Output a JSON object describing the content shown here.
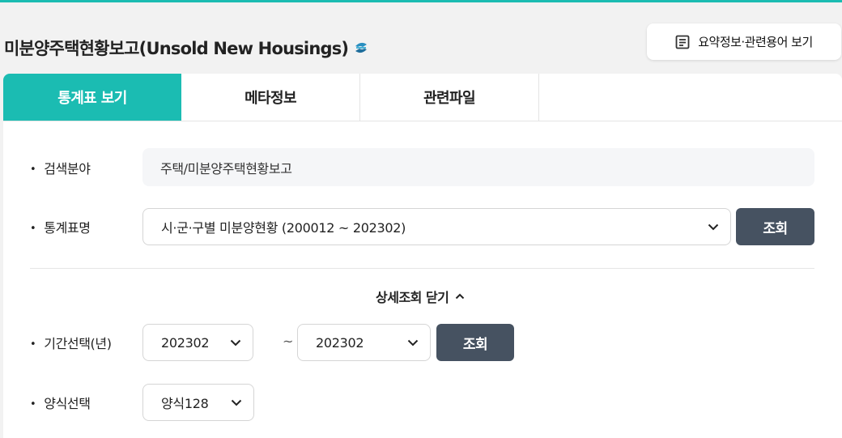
{
  "header": {
    "title": "미분양주택현황보고(Unsold New Housings)",
    "title_icon": "share-icon",
    "summary_button_label": "요약정보·관련용어 보기",
    "summary_button_icon": "document-list-icon"
  },
  "tabs": [
    {
      "label": "통계표 보기",
      "active": true
    },
    {
      "label": "메타정보",
      "active": false
    },
    {
      "label": "관련파일",
      "active": false
    }
  ],
  "form": {
    "category": {
      "label": "검색분야",
      "value": "주택/미분양주택현황보고"
    },
    "table_name": {
      "label": "통계표명",
      "value": "시·군·구별 미분양현황 (200012 ~ 202302)",
      "search_label": "조회"
    },
    "detail_toggle_label": "상세조회 닫기",
    "period": {
      "label": "기간선택(년)",
      "from": "202302",
      "separator": "~",
      "to": "202302",
      "search_label": "조회"
    },
    "format": {
      "label": "양식선택",
      "value": "양식128"
    }
  },
  "colors": {
    "accent": "#1bbcb2",
    "dark_button": "#465261",
    "title_icon": "#1f8fb8"
  }
}
